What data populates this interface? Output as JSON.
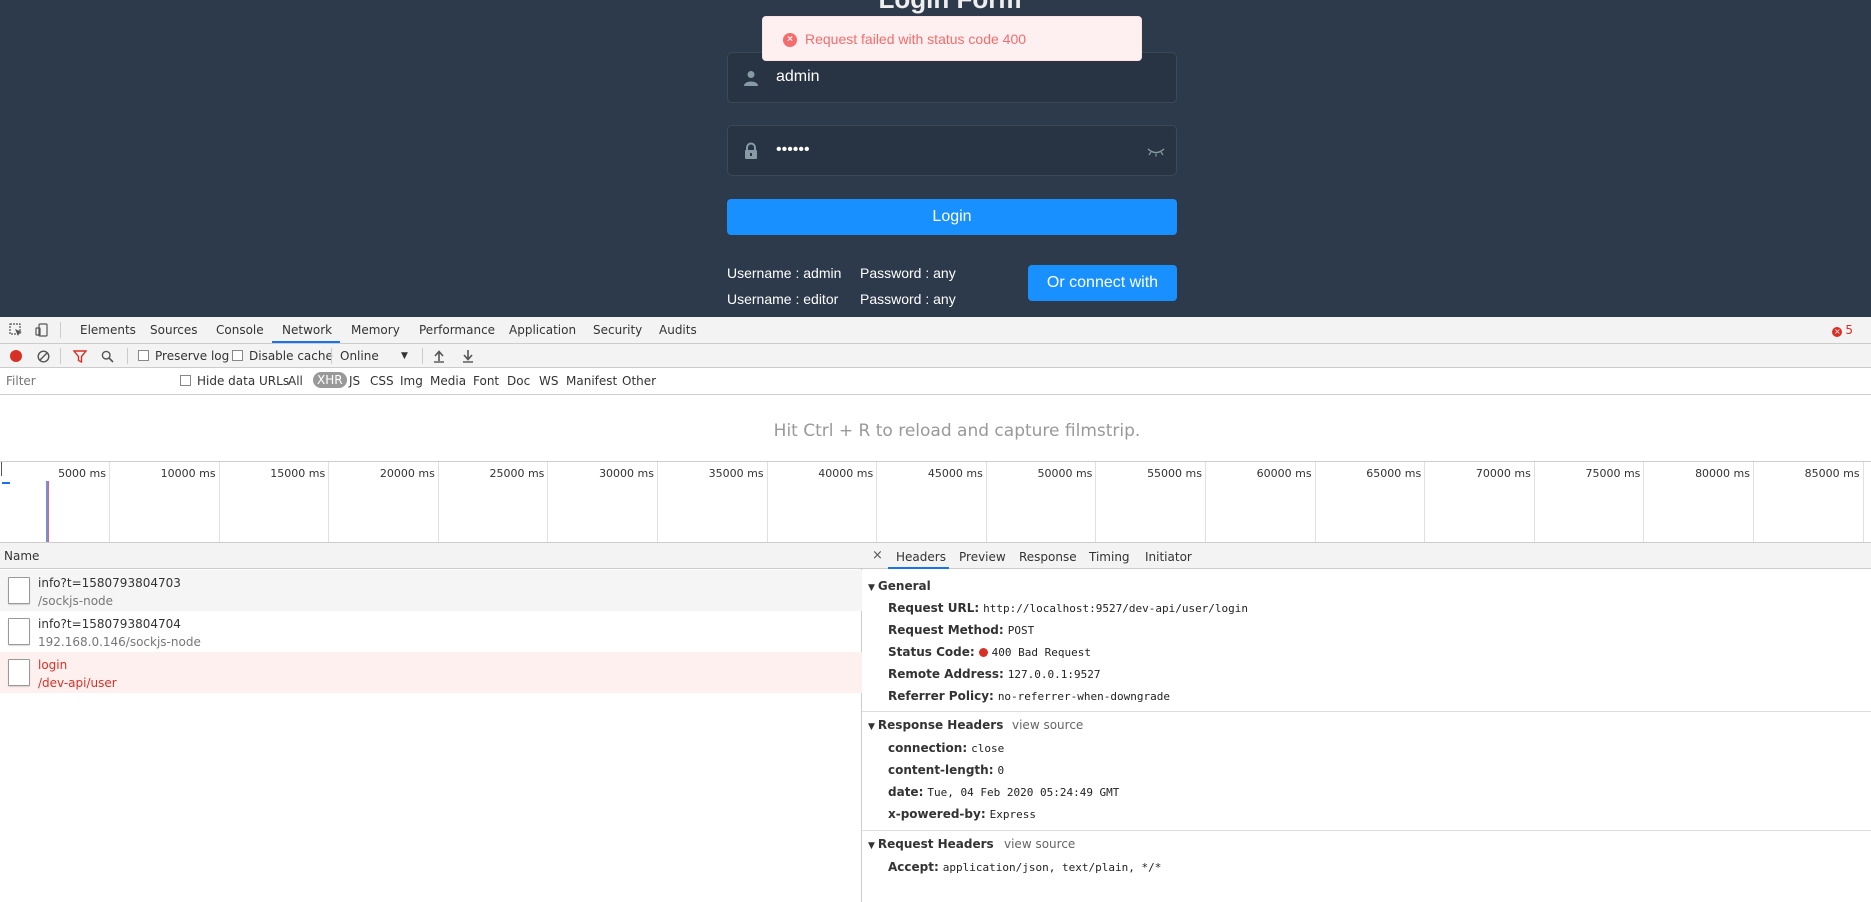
{
  "app": {
    "title": "Login Form",
    "toast_message": "Request failed with status code 400",
    "username_value": "admin",
    "password_value": "••••••",
    "login_label": "Login",
    "tips": [
      {
        "user": "Username : admin",
        "pass": "Password : any"
      },
      {
        "user": "Username : editor",
        "pass": "Password : any"
      }
    ],
    "connect_label": "Or connect with"
  },
  "devtools": {
    "tabs": [
      "Elements",
      "Sources",
      "Console",
      "Network",
      "Memory",
      "Performance",
      "Application",
      "Security",
      "Audits"
    ],
    "active_tab": "Network",
    "error_count": "5",
    "toolbar": {
      "preserve_log": "Preserve log",
      "disable_cache": "Disable cache",
      "throttle": "Online"
    },
    "filter": {
      "placeholder": "Filter",
      "hide_data_urls": "Hide data URLs",
      "types": [
        "All",
        "XHR",
        "JS",
        "CSS",
        "Img",
        "Media",
        "Font",
        "Doc",
        "WS",
        "Manifest",
        "Other"
      ],
      "selected_type": "XHR"
    },
    "filmstrip_message": "Hit Ctrl + R to reload and capture filmstrip.",
    "timeline_labels": [
      "5000 ms",
      "10000 ms",
      "15000 ms",
      "20000 ms",
      "25000 ms",
      "30000 ms",
      "35000 ms",
      "40000 ms",
      "45000 ms",
      "50000 ms",
      "55000 ms",
      "60000 ms",
      "65000 ms",
      "70000 ms",
      "75000 ms",
      "80000 ms",
      "85000 ms"
    ],
    "requests": {
      "header": "Name",
      "rows": [
        {
          "name": "info?t=1580793804703",
          "path": "/sockjs-node"
        },
        {
          "name": "info?t=1580793804704",
          "path": "192.168.0.146/sockjs-node"
        },
        {
          "name": "login",
          "path": "/dev-api/user"
        }
      ]
    },
    "details": {
      "close": "×",
      "tabs": [
        "Headers",
        "Preview",
        "Response",
        "Timing",
        "Initiator"
      ],
      "active_tab": "Headers",
      "general": {
        "title": "General",
        "request_url_key": "Request URL:",
        "request_url": "http://localhost:9527/dev-api/user/login",
        "method_key": "Request Method:",
        "method": "POST",
        "status_key": "Status Code:",
        "status": "400 Bad Request",
        "remote_key": "Remote Address:",
        "remote": "127.0.0.1:9527",
        "referrer_key": "Referrer Policy:",
        "referrer": "no-referrer-when-downgrade"
      },
      "response_headers": {
        "title": "Response Headers",
        "view_source": "view source",
        "items": [
          {
            "k": "connection:",
            "v": "close"
          },
          {
            "k": "content-length:",
            "v": "0"
          },
          {
            "k": "date:",
            "v": "Tue, 04 Feb 2020 05:24:49 GMT"
          },
          {
            "k": "x-powered-by:",
            "v": "Express"
          }
        ]
      },
      "request_headers": {
        "title": "Request Headers",
        "view_source": "view source",
        "items": [
          {
            "k": "Accept:",
            "v": "application/json, text/plain, */*"
          }
        ]
      }
    }
  }
}
